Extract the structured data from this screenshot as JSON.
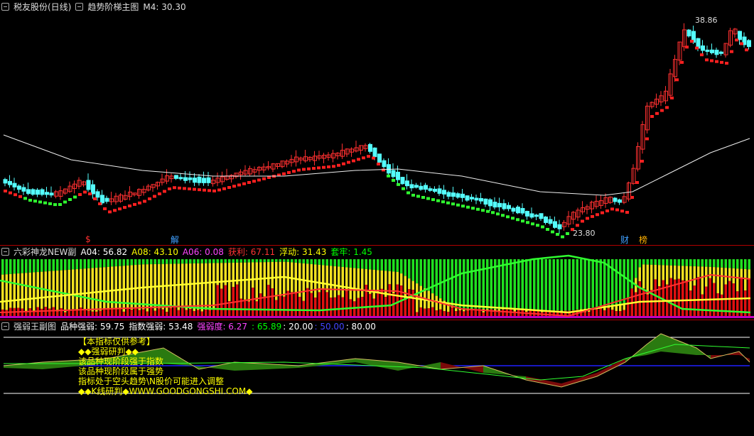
{
  "main": {
    "title": "税友股份(日线)",
    "indicator": "趋势阶梯主图",
    "m4_label": "M4: 30.30",
    "high_label": "38.86",
    "low_label": "23.80",
    "markers": [
      {
        "text": "$",
        "color": "#ff3030"
      },
      {
        "text": "解",
        "color": "#40a0ff"
      },
      {
        "text": "财",
        "color": "#40a0ff"
      },
      {
        "text": "榜",
        "color": "#ffb000"
      }
    ]
  },
  "sub1": {
    "indicator": "六彩神龙NEW副",
    "values": [
      {
        "text": "A04: 56.82",
        "color": "#ffffff"
      },
      {
        "text": "A08: 43.10",
        "color": "#ffff00"
      },
      {
        "text": "A06: 0.08",
        "color": "#ff40ff"
      },
      {
        "text": "获利: 67.11",
        "color": "#ff3030"
      },
      {
        "text": "浮动: 31.43",
        "color": "#ffff00"
      },
      {
        "text": "套牢: 1.45",
        "color": "#00ff00"
      }
    ]
  },
  "sub2": {
    "indicator": "强弱王副图",
    "values": [
      {
        "text": "品种强弱: 59.75",
        "color": "#ffffff"
      },
      {
        "text": "指数强弱: 53.48",
        "color": "#ffffff"
      },
      {
        "text": "强弱度: 6.27",
        "color": "#ff40ff"
      },
      {
        "text": ": 65.89",
        "color": "#00ff00"
      },
      {
        "text": ": 20.00",
        "color": "#ffffff"
      },
      {
        "text": ": 50.00",
        "color": "#4040ff"
      },
      {
        "text": ": 80.00",
        "color": "#ffffff"
      }
    ],
    "notes": [
      "【本指标仅供参考】",
      "◆◆强弱研判◆◆",
      "该品种现阶段强于指数",
      "该品种现阶段属于强势",
      "指标处于空头趋势\\N股价可能进入调整",
      "◆◆K线研判◆WWW.GOODGONGSHI.COM◆"
    ]
  },
  "colors": {
    "bull": "#ff3030",
    "bear": "#54fcfc",
    "background": "#000000",
    "separator": "#b00000"
  }
}
